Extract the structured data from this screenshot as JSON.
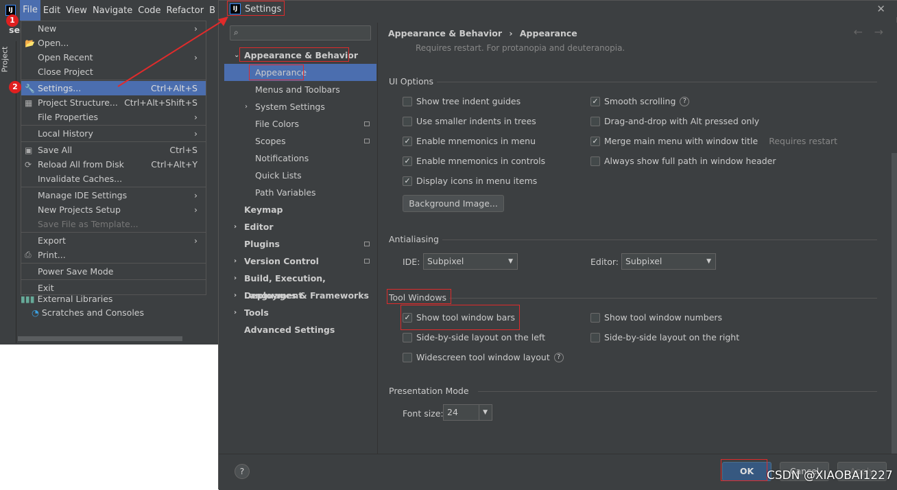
{
  "ide": {
    "logo": "IJ",
    "menubar": [
      "File",
      "Edit",
      "View",
      "Navigate",
      "Code",
      "Refactor",
      "B"
    ],
    "project_label": "ser",
    "tool_window": "Project",
    "tree": [
      {
        "label": "External Libraries",
        "icon": "library-icon"
      },
      {
        "label": "Scratches and Consoles",
        "icon": "scratches-icon"
      }
    ]
  },
  "file_menu": {
    "items": [
      {
        "label": "New",
        "submenu": true
      },
      {
        "label": "Open...",
        "icon": "folder-icon"
      },
      {
        "label": "Open Recent",
        "submenu": true
      },
      {
        "label": "Close Project"
      },
      {
        "sep": true
      },
      {
        "label": "Settings...",
        "shortcut": "Ctrl+Alt+S",
        "icon": "wrench-icon",
        "selected": true
      },
      {
        "label": "Project Structure...",
        "shortcut": "Ctrl+Alt+Shift+S",
        "icon": "project-structure-icon"
      },
      {
        "label": "File Properties",
        "submenu": true
      },
      {
        "sep": true
      },
      {
        "label": "Local History",
        "submenu": true
      },
      {
        "sep": true
      },
      {
        "label": "Save All",
        "shortcut": "Ctrl+S",
        "icon": "save-icon"
      },
      {
        "label": "Reload All from Disk",
        "shortcut": "Ctrl+Alt+Y",
        "icon": "reload-icon"
      },
      {
        "label": "Invalidate Caches..."
      },
      {
        "sep": true
      },
      {
        "label": "Manage IDE Settings",
        "submenu": true
      },
      {
        "label": "New Projects Setup",
        "submenu": true
      },
      {
        "label": "Save File as Template...",
        "disabled": true
      },
      {
        "sep": true
      },
      {
        "label": "Export",
        "submenu": true
      },
      {
        "label": "Print...",
        "icon": "print-icon"
      },
      {
        "sep": true
      },
      {
        "label": "Power Save Mode"
      },
      {
        "sep": true
      },
      {
        "label": "Exit"
      }
    ]
  },
  "annotations": {
    "step1": "1",
    "step2": "2",
    "accent": "#e02b2b"
  },
  "settings": {
    "title": "Settings",
    "logo": "IJ",
    "search_placeholder": "",
    "nav": [
      {
        "label": "Appearance & Behavior",
        "bold": true,
        "expanded": true
      },
      {
        "label": "Appearance",
        "sub": true,
        "selected": true
      },
      {
        "label": "Menus and Toolbars",
        "sub": true
      },
      {
        "label": "System Settings",
        "sub": true,
        "chevron": true
      },
      {
        "label": "File Colors",
        "sub": true,
        "page": true
      },
      {
        "label": "Scopes",
        "sub": true,
        "page": true
      },
      {
        "label": "Notifications",
        "sub": true
      },
      {
        "label": "Quick Lists",
        "sub": true
      },
      {
        "label": "Path Variables",
        "sub": true
      },
      {
        "label": "Keymap",
        "bold": true
      },
      {
        "label": "Editor",
        "bold": true,
        "chevron": true
      },
      {
        "label": "Plugins",
        "bold": true,
        "page": true
      },
      {
        "label": "Version Control",
        "bold": true,
        "chevron": true,
        "page": true
      },
      {
        "label": "Build, Execution, Deployment",
        "bold": true,
        "chevron": true
      },
      {
        "label": "Languages & Frameworks",
        "bold": true,
        "chevron": true
      },
      {
        "label": "Tools",
        "bold": true,
        "chevron": true
      },
      {
        "label": "Advanced Settings",
        "bold": true
      }
    ],
    "breadcrumb": [
      "Appearance & Behavior",
      "Appearance"
    ],
    "note": "Requires restart. For protanopia and deuteranopia.",
    "ui_options": {
      "title": "UI Options",
      "left": [
        {
          "label": "Show tree indent guides",
          "checked": false
        },
        {
          "label": "Use smaller indents in trees",
          "checked": false
        },
        {
          "label": "Enable mnemonics in menu",
          "checked": true
        },
        {
          "label": "Enable mnemonics in controls",
          "checked": true
        },
        {
          "label": "Display icons in menu items",
          "checked": true
        }
      ],
      "right": [
        {
          "label": "Smooth scrolling",
          "checked": true,
          "help": true
        },
        {
          "label": "Drag-and-drop with Alt pressed only",
          "checked": false
        },
        {
          "label": "Merge main menu with window title",
          "checked": true,
          "hint": "Requires restart"
        },
        {
          "label": "Always show full path in window header",
          "checked": false
        }
      ],
      "bg_button": "Background Image..."
    },
    "antialiasing": {
      "title": "Antialiasing",
      "ide_label": "IDE:",
      "ide_value": "Subpixel",
      "editor_label": "Editor:",
      "editor_value": "Subpixel"
    },
    "tool_windows": {
      "title": "Tool Windows",
      "items": [
        {
          "label": "Show tool window bars",
          "checked": true
        },
        {
          "label": "Show tool window numbers",
          "checked": false
        },
        {
          "label": "Side-by-side layout on the left",
          "checked": false
        },
        {
          "label": "Side-by-side layout on the right",
          "checked": false
        },
        {
          "label": "Widescreen tool window layout",
          "checked": false,
          "help": true
        }
      ]
    },
    "presentation": {
      "title": "Presentation Mode",
      "font_label": "Font size:",
      "font_value": "24"
    },
    "buttons": {
      "ok": "OK",
      "cancel": "Cancel",
      "apply": "Apply",
      "help": "?"
    }
  },
  "watermark": "CSDN @XIAOBAI1227"
}
